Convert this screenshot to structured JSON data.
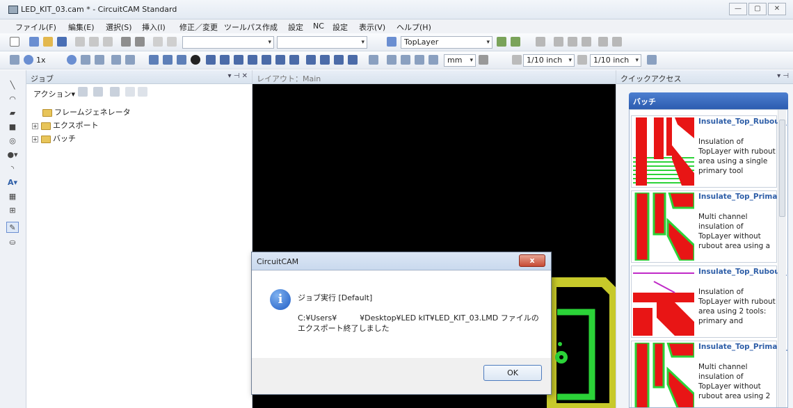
{
  "window": {
    "title": "LED_KIT_03.cam * - CircuitCAM Standard",
    "controls": [
      "—",
      "▢",
      "✕"
    ]
  },
  "menu": [
    "ファイル(F)",
    "編集(E)",
    "選択(S)",
    "挿入(I)",
    "修正／変更",
    "ツールパス作成",
    "設定",
    "NC",
    "設定",
    "表示(V)",
    "ヘルプ(H)"
  ],
  "toolbar1": {
    "layer_combo": "TopLayer"
  },
  "toolbar2": {
    "zoom_label": "1x",
    "unit_combo": "mm",
    "grid1_combo": "1/10 inch",
    "grid2_combo": "1/10 inch"
  },
  "job_panel": {
    "title": "ジョブ",
    "pin": "▾ ⊣ ✕",
    "action_label": "アクション▾",
    "tree": [
      {
        "label": "フレームジェネレータ",
        "expander": ""
      },
      {
        "label": "エクスポート",
        "expander": "+"
      },
      {
        "label": "バッチ",
        "expander": "+"
      }
    ]
  },
  "layout_panel": {
    "title": "レイアウト：Main"
  },
  "quick_panel": {
    "title": "クイックアクセス",
    "pin": "▾ ⊣",
    "section": "バッチ",
    "cards": [
      {
        "title": "Insulate_Top_Rubout_Primary",
        "desc": "Insulation of TopLayer with rubout area using a single primary tool"
      },
      {
        "title": "Insulate_Top_Primary",
        "desc": "Multi channel insulation of TopLayer without rubout area using a"
      },
      {
        "title": "Insulate_Top_Rubout_Big_Primary",
        "desc": "Insulation of TopLayer with rubout area using 2 tools: primary and"
      },
      {
        "title": "Insulate_Top_Primary_Small",
        "desc": "Multi channel insulation of TopLayer without rubout area using 2"
      }
    ]
  },
  "dialog": {
    "title": "CircuitCAM",
    "close": "x",
    "icon": "info-icon",
    "message_title": "ジョブ実行 [Default]",
    "message": "C:¥Users¥　　　¥Desktop¥LED kIT¥LED_KIT_03.LMD ファイルのエクスポート終了しました",
    "ok": "OK"
  }
}
